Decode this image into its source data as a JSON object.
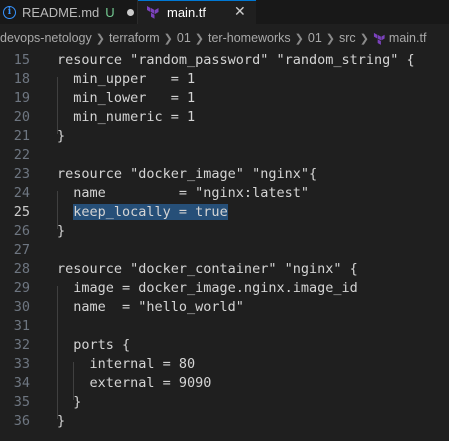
{
  "tabs": [
    {
      "label": "README.md",
      "status": "U"
    },
    {
      "label": "main.tf",
      "close": "✕"
    }
  ],
  "breadcrumb": [
    "devops-netology",
    "terraform",
    "01",
    "ter-homeworks",
    "01",
    "src",
    "main.tf"
  ],
  "editor": {
    "lines": [
      {
        "n": "15",
        "text": "resource \"random_password\" \"random_string\" {"
      },
      {
        "n": "18",
        "text": "  min_upper   = 1"
      },
      {
        "n": "19",
        "text": "  min_lower   = 1"
      },
      {
        "n": "20",
        "text": "  min_numeric = 1"
      },
      {
        "n": "21",
        "text": "}"
      },
      {
        "n": "22",
        "text": ""
      },
      {
        "n": "23",
        "text": "resource \"docker_image\" \"nginx\"{"
      },
      {
        "n": "24",
        "text": "  name         = \"nginx:latest\""
      },
      {
        "n": "25",
        "text": "  keep_locally = true"
      },
      {
        "n": "26",
        "text": "}"
      },
      {
        "n": "27",
        "text": ""
      },
      {
        "n": "28",
        "text": "resource \"docker_container\" \"nginx\" {"
      },
      {
        "n": "29",
        "text": "  image = docker_image.nginx.image_id"
      },
      {
        "n": "30",
        "text": "  name  = \"hello_world\""
      },
      {
        "n": "31",
        "text": ""
      },
      {
        "n": "32",
        "text": "  ports {"
      },
      {
        "n": "33",
        "text": "    internal = 80"
      },
      {
        "n": "34",
        "text": "    external = 9090"
      },
      {
        "n": "35",
        "text": "  }"
      },
      {
        "n": "36",
        "text": "}"
      }
    ],
    "active_line": "25",
    "selection": "keep_locally = true"
  },
  "colors": {
    "background": "#1f1f1f",
    "selection": "#264f78",
    "terraform_icon": "#7b42bc",
    "untracked": "#73c991",
    "info": "#3794ff"
  }
}
